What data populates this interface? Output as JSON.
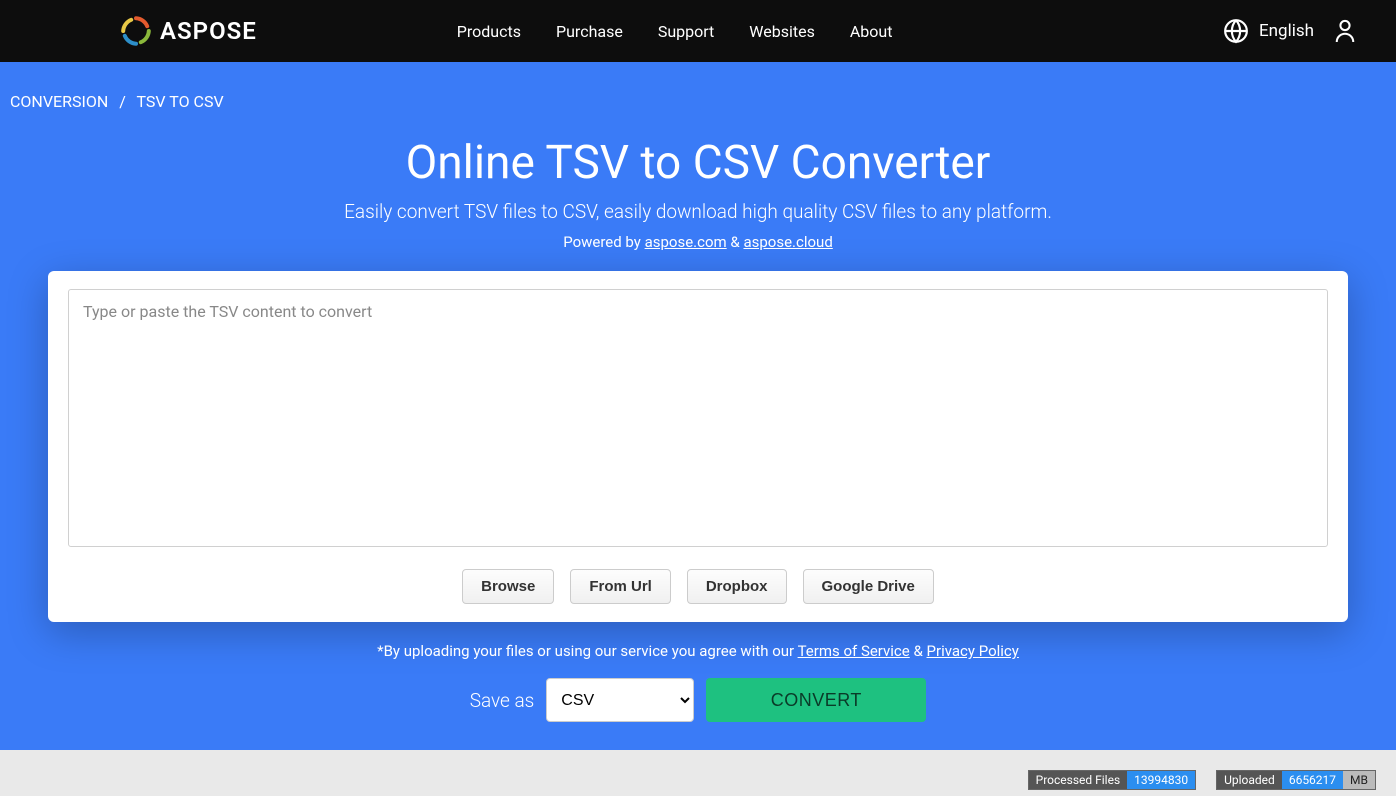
{
  "brand": "ASPOSE",
  "nav": {
    "products": "Products",
    "purchase": "Purchase",
    "support": "Support",
    "websites": "Websites",
    "about": "About"
  },
  "lang": "English",
  "breadcrumb": {
    "conversion": "CONVERSION",
    "current": "TSV TO CSV"
  },
  "title": "Online TSV to CSV Converter",
  "subtitle": "Easily convert TSV files to CSV, easily download high quality CSV files to any platform.",
  "powered": {
    "prefix": "Powered by ",
    "link1": "aspose.com",
    "amp": " & ",
    "link2": "aspose.cloud"
  },
  "input": {
    "placeholder": "Type or paste the TSV content to convert",
    "value": ""
  },
  "sources": {
    "browse": "Browse",
    "fromurl": "From Url",
    "dropbox": "Dropbox",
    "gdrive": "Google Drive"
  },
  "terms": {
    "prefix": "*By uploading your files or using our service you agree with our ",
    "tos": "Terms of Service",
    "amp": " & ",
    "pp": "Privacy Policy"
  },
  "save": {
    "label": "Save as",
    "selected": "CSV",
    "convert": "CONVERT"
  },
  "stats": {
    "processed_label": "Processed Files",
    "processed_value": "13994830",
    "uploaded_label": "Uploaded",
    "uploaded_value": "6656217",
    "uploaded_unit": "MB"
  }
}
